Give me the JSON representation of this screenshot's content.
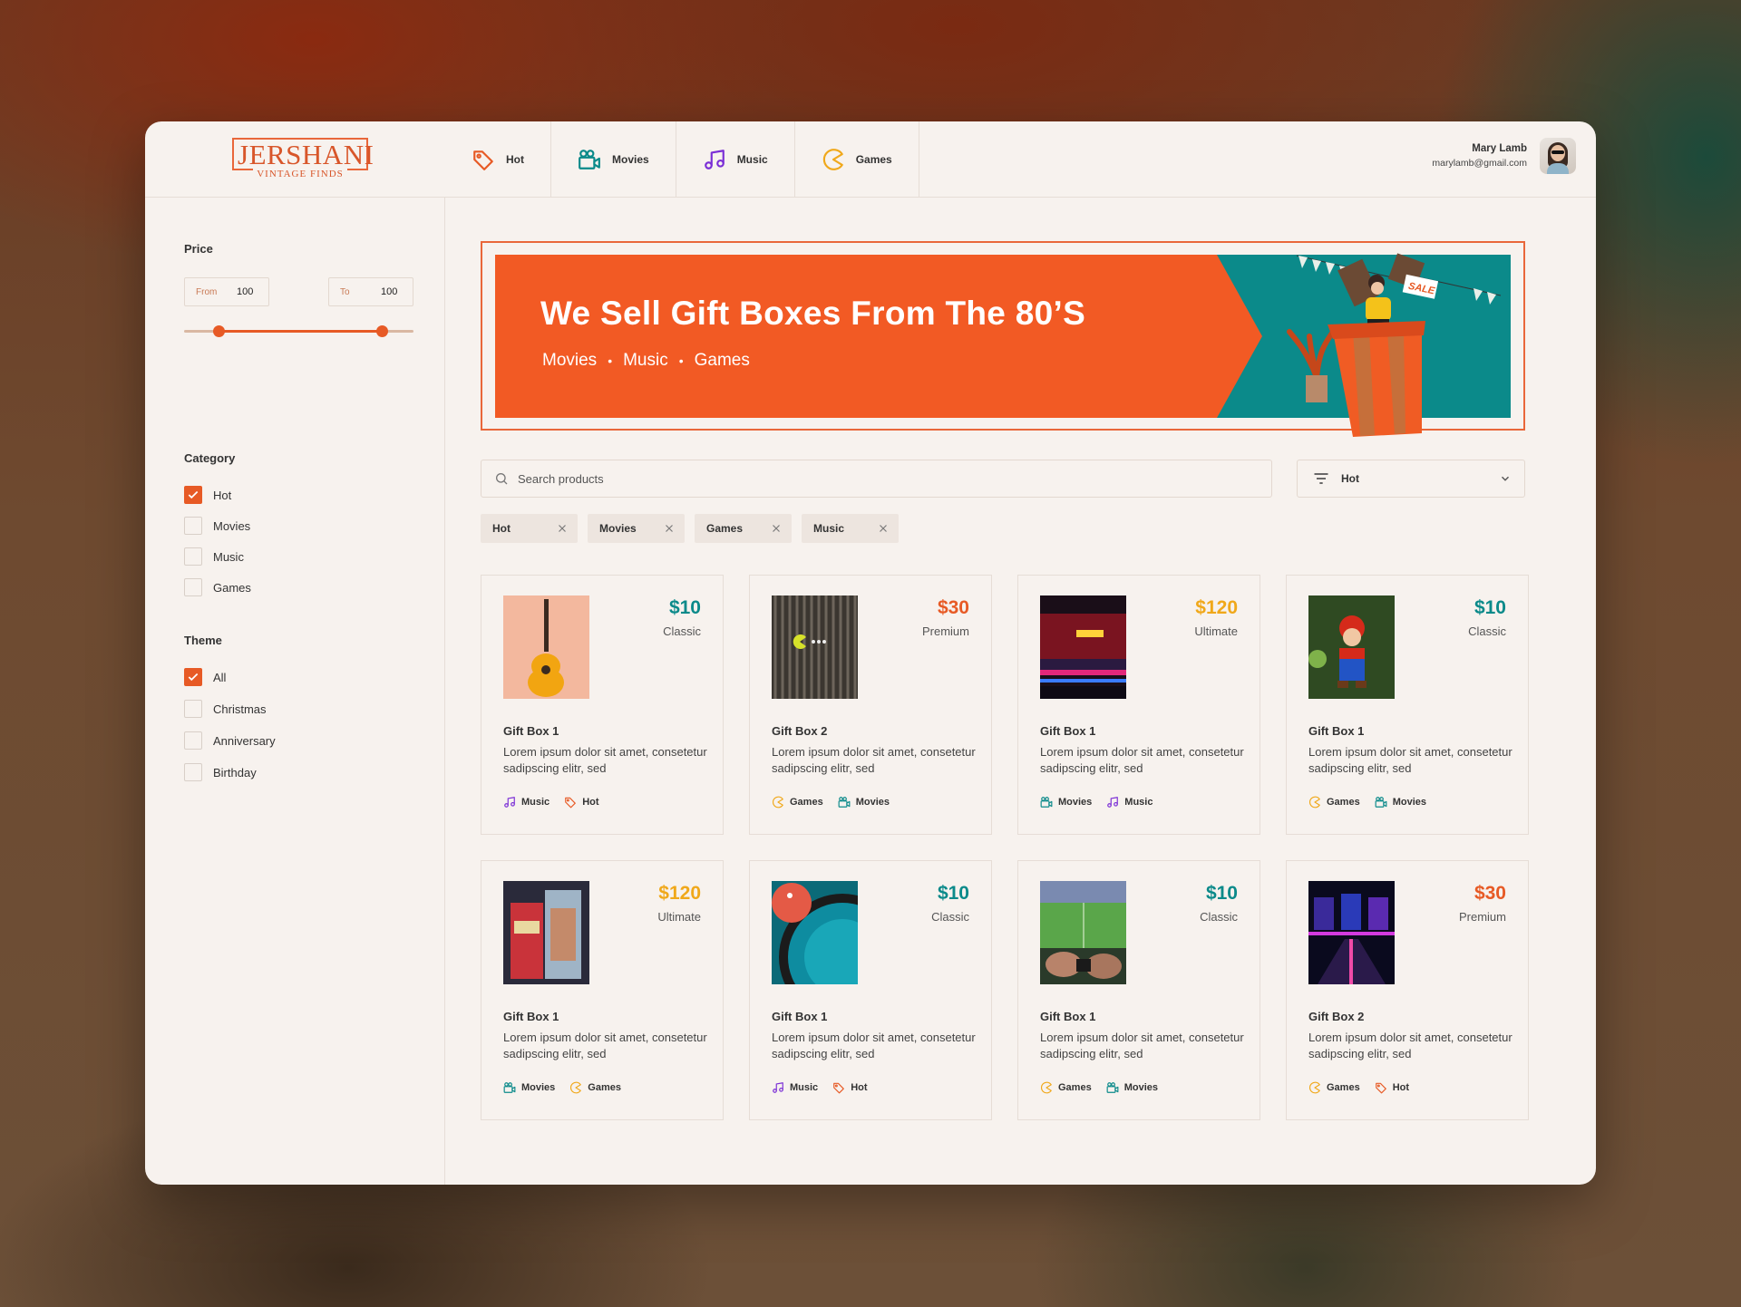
{
  "brand": {
    "name": "JERSHANI",
    "tagline": "VINTAGE FINDS"
  },
  "nav": [
    {
      "label": "Hot",
      "icon": "tag-icon",
      "color": "#e75a25"
    },
    {
      "label": "Movies",
      "icon": "camera-icon",
      "color": "#0b8a8a"
    },
    {
      "label": "Music",
      "icon": "music-note-icon",
      "color": "#7b2fd6"
    },
    {
      "label": "Games",
      "icon": "pacman-icon",
      "color": "#f0a81a"
    }
  ],
  "user": {
    "name": "Mary Lamb",
    "email": "marylamb@gmail.com"
  },
  "filters": {
    "price": {
      "title": "Price",
      "from_label": "From",
      "from_value": "100",
      "to_label": "To",
      "to_value": "100",
      "range_low_fraction": 0.15,
      "range_high_fraction": 0.86
    },
    "category": {
      "title": "Category",
      "options": [
        {
          "label": "Hot",
          "checked": true
        },
        {
          "label": "Movies",
          "checked": false
        },
        {
          "label": "Music",
          "checked": false
        },
        {
          "label": "Games",
          "checked": false
        }
      ]
    },
    "theme": {
      "title": "Theme",
      "options": [
        {
          "label": "All",
          "checked": true
        },
        {
          "label": "Christmas",
          "checked": false
        },
        {
          "label": "Anniversary",
          "checked": false
        },
        {
          "label": "Birthday",
          "checked": false
        }
      ]
    }
  },
  "banner": {
    "title": "We Sell Gift Boxes From The 80’S",
    "categories": [
      "Movies",
      "Music",
      "Games"
    ],
    "sale_label": "SALE"
  },
  "search": {
    "placeholder": "Search products"
  },
  "sort": {
    "selected": "Hot"
  },
  "chips": [
    "Hot",
    "Movies",
    "Games",
    "Music"
  ],
  "colors": {
    "accent": "#e75a25",
    "teal": "#0b8a8a",
    "gold": "#f0a81a",
    "purple": "#7b2fd6"
  },
  "products": [
    {
      "name": "Gift Box 1",
      "price": "$10",
      "tier": "Classic",
      "price_color": "#0b8a8a",
      "desc": "Lorem ipsum dolor sit amet, consetetur sadipscing elitr, sed",
      "image": "guitar",
      "tags": [
        "Music",
        "Hot"
      ]
    },
    {
      "name": "Gift Box 2",
      "price": "$30",
      "tier": "Premium",
      "price_color": "#e75a25",
      "desc": "Lorem ipsum dolor sit amet, consetetur sadipscing elitr, sed",
      "image": "pacman-wall",
      "tags": [
        "Games",
        "Movies"
      ]
    },
    {
      "name": "Gift Box 1",
      "price": "$120",
      "tier": "Ultimate",
      "price_color": "#f0a81a",
      "desc": "Lorem ipsum dolor sit amet, consetetur sadipscing elitr, sed",
      "image": "neon-theater",
      "tags": [
        "Movies",
        "Music"
      ]
    },
    {
      "name": "Gift Box 1",
      "price": "$10",
      "tier": "Classic",
      "price_color": "#0b8a8a",
      "desc": "Lorem ipsum dolor sit amet, consetetur sadipscing elitr, sed",
      "image": "mario-figure",
      "tags": [
        "Games",
        "Movies"
      ]
    },
    {
      "name": "Gift Box 1",
      "price": "$120",
      "tier": "Ultimate",
      "price_color": "#f0a81a",
      "desc": "Lorem ipsum dolor sit amet, consetetur sadipscing elitr, sed",
      "image": "vhs-tapes",
      "tags": [
        "Movies",
        "Games"
      ]
    },
    {
      "name": "Gift Box 1",
      "price": "$10",
      "tier": "Classic",
      "price_color": "#0b8a8a",
      "desc": "Lorem ipsum dolor sit amet, consetetur sadipscing elitr, sed",
      "image": "vinyl-record",
      "tags": [
        "Music",
        "Hot"
      ]
    },
    {
      "name": "Gift Box 1",
      "price": "$10",
      "tier": "Classic",
      "price_color": "#0b8a8a",
      "desc": "Lorem ipsum dolor sit amet, consetetur sadipscing elitr, sed",
      "image": "soccer-game",
      "tags": [
        "Games",
        "Movies"
      ]
    },
    {
      "name": "Gift Box 2",
      "price": "$30",
      "tier": "Premium",
      "price_color": "#e75a25",
      "desc": "Lorem ipsum dolor sit amet, consetetur sadipscing elitr, sed",
      "image": "arcade-lights",
      "tags": [
        "Games",
        "Hot"
      ]
    }
  ]
}
